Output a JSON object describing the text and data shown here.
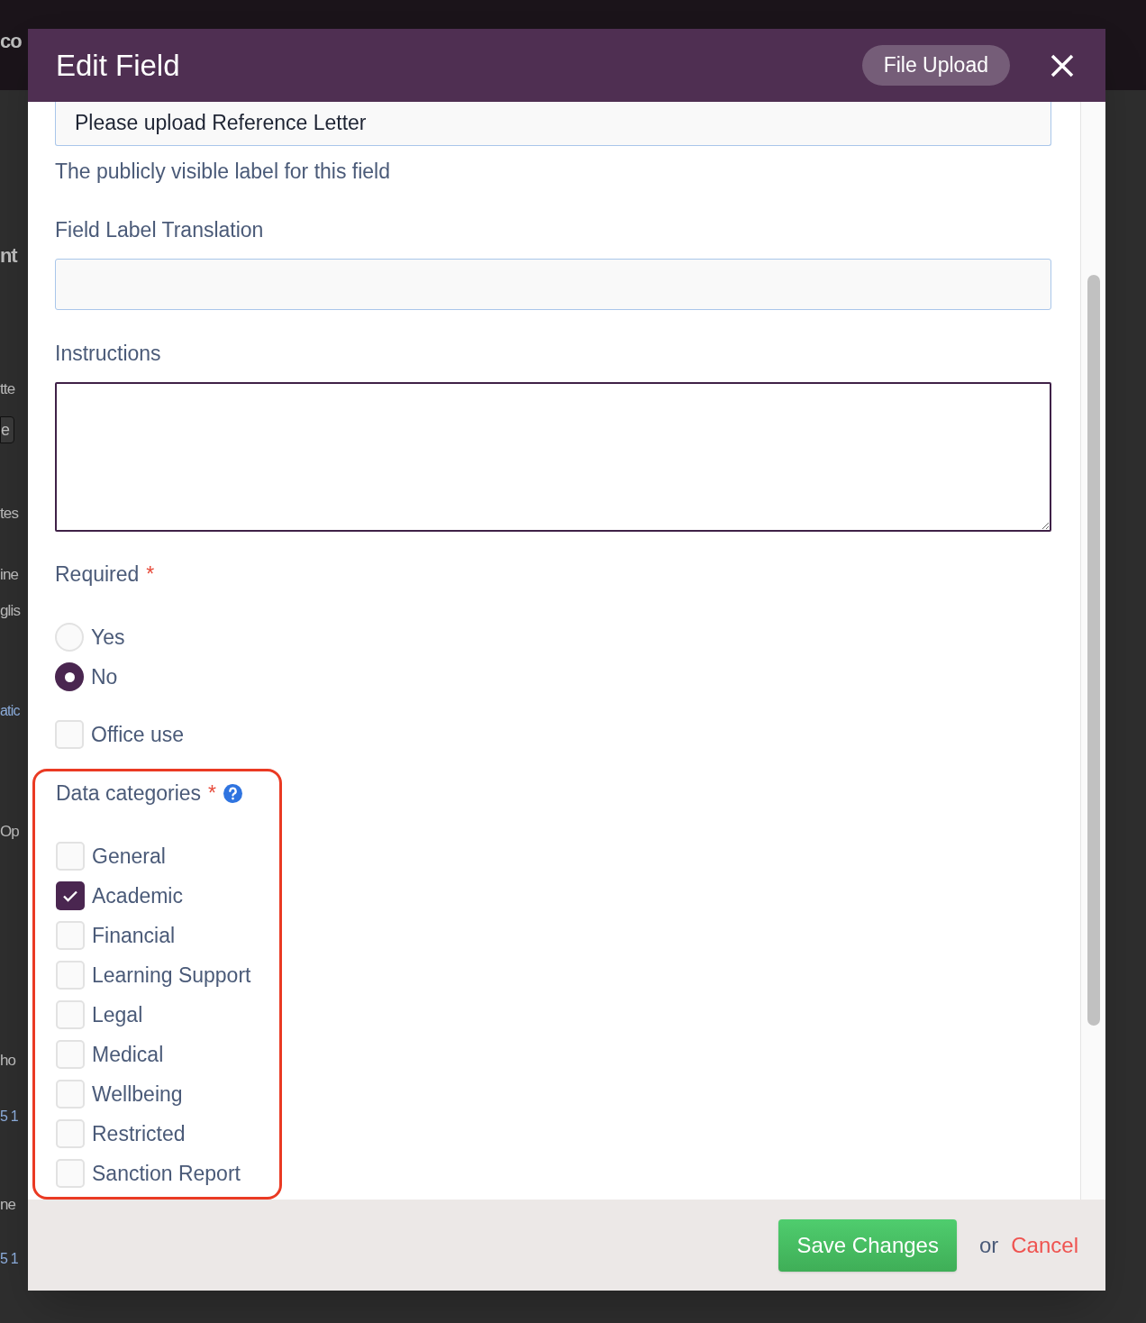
{
  "backdrop": {
    "fragments": [
      {
        "text": "co",
        "kind": "heading"
      },
      {
        "text": "nt",
        "kind": "heading"
      },
      {
        "text": "tte",
        "kind": "text"
      },
      {
        "text": "e",
        "kind": "button"
      },
      {
        "text": "tes",
        "kind": "text"
      },
      {
        "text": "ine",
        "kind": "text"
      },
      {
        "text": "glis",
        "kind": "text"
      },
      {
        "text": "atic",
        "kind": "link"
      },
      {
        "text": "Op",
        "kind": "text"
      },
      {
        "text": "ho",
        "kind": "text"
      },
      {
        "text": "5 1",
        "kind": "link"
      },
      {
        "text": "ne",
        "kind": "text"
      },
      {
        "text": "5 1",
        "kind": "link"
      }
    ]
  },
  "modal": {
    "title": "Edit Field",
    "type_badge": "File Upload",
    "label_field": {
      "value": "Please upload Reference Letter",
      "hint": "The publicly visible label for this field"
    },
    "translation_field": {
      "label": "Field Label Translation"
    },
    "instructions_field": {
      "label": "Instructions"
    },
    "required": {
      "label": "Required",
      "mark": "*",
      "options": [
        {
          "label": "Yes",
          "selected": false
        },
        {
          "label": "No",
          "selected": true
        }
      ]
    },
    "office_use": {
      "label": "Office use",
      "checked": false
    },
    "data_categories": {
      "label": "Data categories",
      "mark": "*",
      "highlighted": true,
      "items": [
        {
          "label": "General",
          "checked": false
        },
        {
          "label": "Academic",
          "checked": true
        },
        {
          "label": "Financial",
          "checked": false
        },
        {
          "label": "Learning Support",
          "checked": false
        },
        {
          "label": "Legal",
          "checked": false
        },
        {
          "label": "Medical",
          "checked": false
        },
        {
          "label": "Wellbeing",
          "checked": false
        },
        {
          "label": "Restricted",
          "checked": false
        },
        {
          "label": "Sanction Report",
          "checked": false
        }
      ]
    },
    "footer": {
      "save": "Save Changes",
      "or": "or",
      "cancel": "Cancel"
    }
  }
}
